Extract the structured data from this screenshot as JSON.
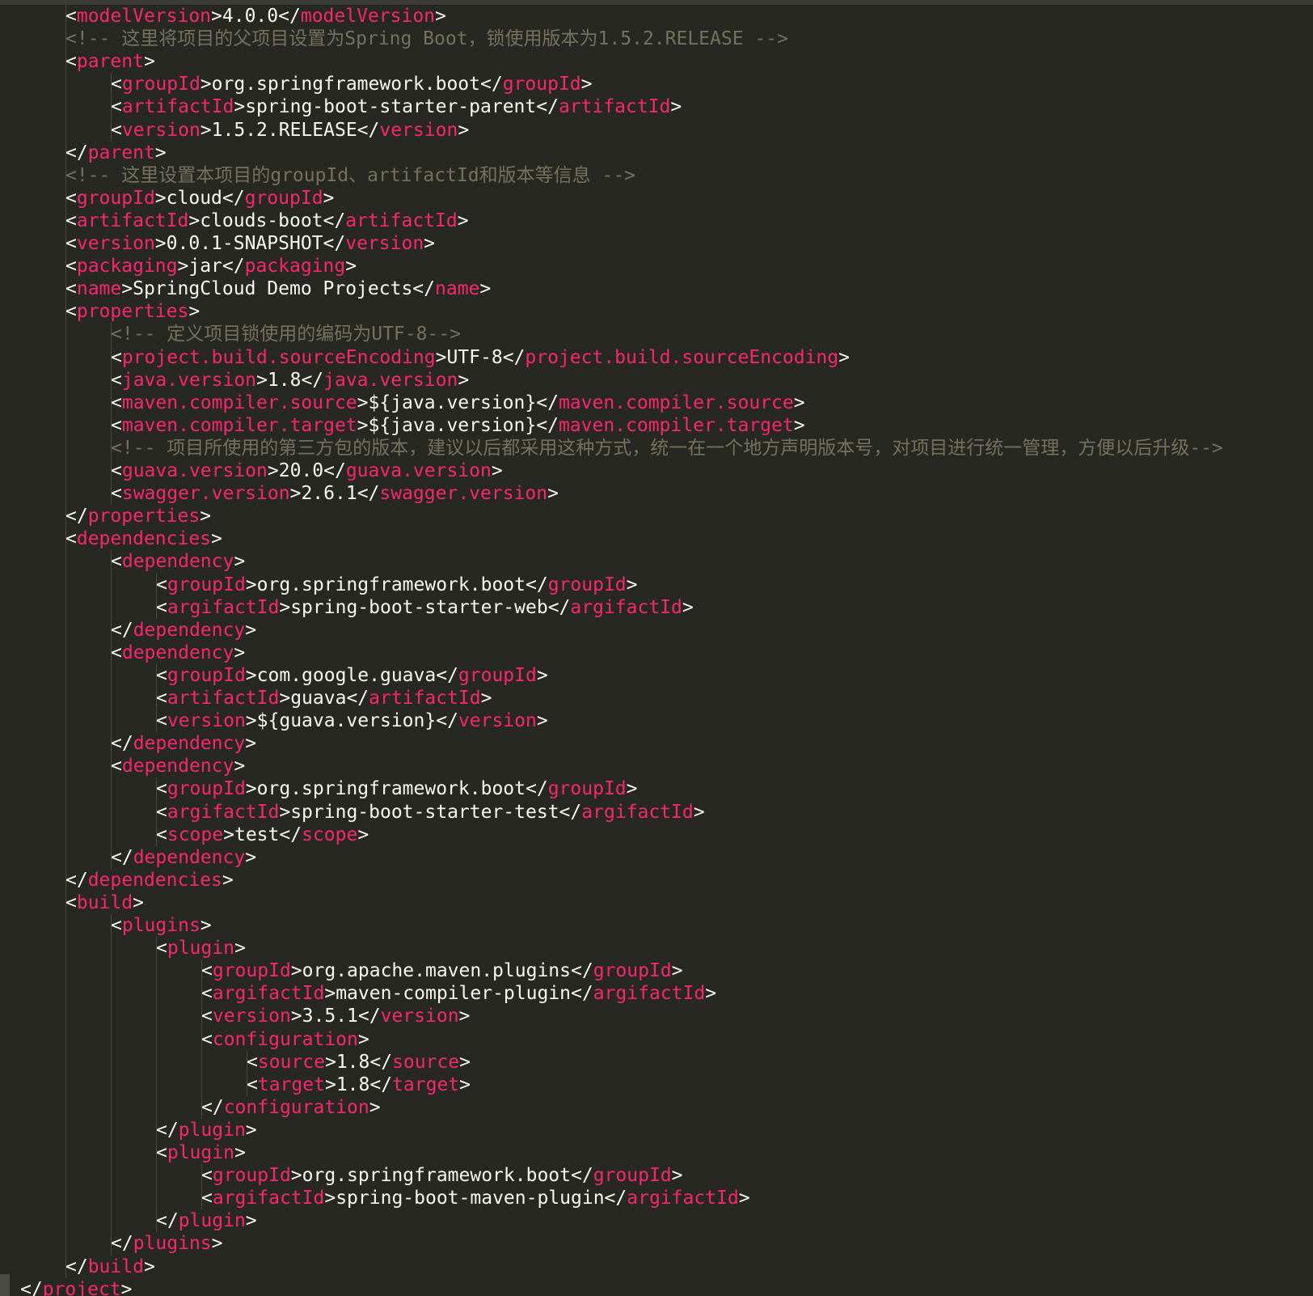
{
  "theme": {
    "background": "#272822",
    "tag_color": "#f92672",
    "text_color": "#f8f8f2",
    "comment_color": "#75715e"
  },
  "lines": [
    {
      "indent": 1,
      "kind": "elem",
      "tag": "modelVersion",
      "text": "4.0.0"
    },
    {
      "indent": 1,
      "kind": "comment",
      "text": "<!-- 这里将项目的父项目设置为Spring Boot，锁使用版本为1.5.2.RELEASE -->"
    },
    {
      "indent": 1,
      "kind": "open",
      "tag": "parent"
    },
    {
      "indent": 2,
      "kind": "elem",
      "tag": "groupId",
      "text": "org.springframework.boot"
    },
    {
      "indent": 2,
      "kind": "elem",
      "tag": "artifactId",
      "text": "spring-boot-starter-parent"
    },
    {
      "indent": 2,
      "kind": "elem",
      "tag": "version",
      "text": "1.5.2.RELEASE"
    },
    {
      "indent": 1,
      "kind": "close",
      "tag": "parent"
    },
    {
      "indent": 1,
      "kind": "comment",
      "text": "<!-- 这里设置本项目的groupId、artifactId和版本等信息 -->"
    },
    {
      "indent": 1,
      "kind": "elem",
      "tag": "groupId",
      "text": "cloud"
    },
    {
      "indent": 1,
      "kind": "elem",
      "tag": "artifactId",
      "text": "clouds-boot"
    },
    {
      "indent": 1,
      "kind": "elem",
      "tag": "version",
      "text": "0.0.1-SNAPSHOT"
    },
    {
      "indent": 1,
      "kind": "elem",
      "tag": "packaging",
      "text": "jar"
    },
    {
      "indent": 1,
      "kind": "elem",
      "tag": "name",
      "text": "SpringCloud Demo Projects"
    },
    {
      "indent": 1,
      "kind": "open",
      "tag": "properties"
    },
    {
      "indent": 2,
      "kind": "comment",
      "text": "<!-- 定义项目锁使用的编码为UTF-8-->"
    },
    {
      "indent": 2,
      "kind": "elem",
      "tag": "project.build.sourceEncoding",
      "text": "UTF-8"
    },
    {
      "indent": 2,
      "kind": "elem",
      "tag": "java.version",
      "text": "1.8"
    },
    {
      "indent": 2,
      "kind": "elem",
      "tag": "maven.compiler.source",
      "text": "${java.version}"
    },
    {
      "indent": 2,
      "kind": "elem",
      "tag": "maven.compiler.target",
      "text": "${java.version}"
    },
    {
      "indent": 2,
      "kind": "comment",
      "text": "<!-- 项目所使用的第三方包的版本，建议以后都采用这种方式，统一在一个地方声明版本号，对项目进行统一管理，方便以后升级-->"
    },
    {
      "indent": 2,
      "kind": "elem",
      "tag": "guava.version",
      "text": "20.0"
    },
    {
      "indent": 2,
      "kind": "elem",
      "tag": "swagger.version",
      "text": "2.6.1"
    },
    {
      "indent": 1,
      "kind": "close",
      "tag": "properties"
    },
    {
      "indent": 1,
      "kind": "open",
      "tag": "dependencies"
    },
    {
      "indent": 2,
      "kind": "open",
      "tag": "dependency"
    },
    {
      "indent": 3,
      "kind": "elem",
      "tag": "groupId",
      "text": "org.springframework.boot"
    },
    {
      "indent": 3,
      "kind": "elem",
      "tag": "argifactId",
      "text": "spring-boot-starter-web"
    },
    {
      "indent": 2,
      "kind": "close",
      "tag": "dependency"
    },
    {
      "indent": 2,
      "kind": "open",
      "tag": "dependency"
    },
    {
      "indent": 3,
      "kind": "elem",
      "tag": "groupId",
      "text": "com.google.guava"
    },
    {
      "indent": 3,
      "kind": "elem",
      "tag": "artifactId",
      "text": "guava"
    },
    {
      "indent": 3,
      "kind": "elem",
      "tag": "version",
      "text": "${guava.version}"
    },
    {
      "indent": 2,
      "kind": "close",
      "tag": "dependency"
    },
    {
      "indent": 2,
      "kind": "open",
      "tag": "dependency"
    },
    {
      "indent": 3,
      "kind": "elem",
      "tag": "groupId",
      "text": "org.springframework.boot"
    },
    {
      "indent": 3,
      "kind": "elem",
      "tag": "argifactId",
      "text": "spring-boot-starter-test"
    },
    {
      "indent": 3,
      "kind": "elem",
      "tag": "scope",
      "text": "test"
    },
    {
      "indent": 2,
      "kind": "close",
      "tag": "dependency"
    },
    {
      "indent": 1,
      "kind": "close",
      "tag": "dependencies"
    },
    {
      "indent": 1,
      "kind": "open",
      "tag": "build"
    },
    {
      "indent": 2,
      "kind": "open",
      "tag": "plugins"
    },
    {
      "indent": 3,
      "kind": "open",
      "tag": "plugin"
    },
    {
      "indent": 4,
      "kind": "elem",
      "tag": "groupId",
      "text": "org.apache.maven.plugins"
    },
    {
      "indent": 4,
      "kind": "elem",
      "tag": "argifactId",
      "text": "maven-compiler-plugin"
    },
    {
      "indent": 4,
      "kind": "elem",
      "tag": "version",
      "text": "3.5.1"
    },
    {
      "indent": 4,
      "kind": "open",
      "tag": "configuration"
    },
    {
      "indent": 5,
      "kind": "elem",
      "tag": "source",
      "text": "1.8"
    },
    {
      "indent": 5,
      "kind": "elem",
      "tag": "target",
      "text": "1.8"
    },
    {
      "indent": 4,
      "kind": "close",
      "tag": "configuration"
    },
    {
      "indent": 3,
      "kind": "close",
      "tag": "plugin"
    },
    {
      "indent": 3,
      "kind": "open",
      "tag": "plugin"
    },
    {
      "indent": 4,
      "kind": "elem",
      "tag": "groupId",
      "text": "org.springframework.boot"
    },
    {
      "indent": 4,
      "kind": "elem",
      "tag": "argifactId",
      "text": "spring-boot-maven-plugin"
    },
    {
      "indent": 3,
      "kind": "close",
      "tag": "plugin"
    },
    {
      "indent": 2,
      "kind": "close",
      "tag": "plugins"
    },
    {
      "indent": 1,
      "kind": "close",
      "tag": "build"
    },
    {
      "indent": 0,
      "kind": "close",
      "tag": "project"
    }
  ]
}
